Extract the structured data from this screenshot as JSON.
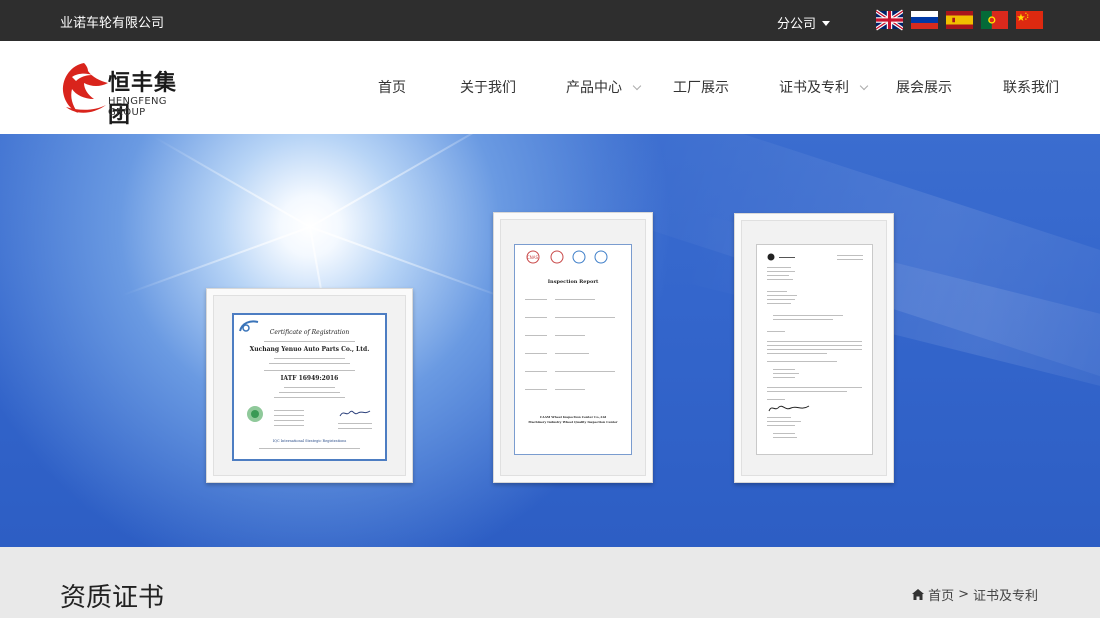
{
  "topbar": {
    "company": "业诺车轮有限公司",
    "branch_label": "分公司",
    "flags": [
      "uk-flag-icon",
      "russia-flag-icon",
      "spain-flag-icon",
      "portugal-flag-icon",
      "china-flag-icon"
    ]
  },
  "logo": {
    "cn": "恒丰集团",
    "en": "HENGFENG GROUP",
    "color": "#d9241c"
  },
  "nav": {
    "items": [
      {
        "label": "首页"
      },
      {
        "label": "关于我们"
      },
      {
        "label": "产品中心"
      },
      {
        "label": "工厂展示"
      },
      {
        "label": "证书及专利"
      },
      {
        "label": "展会展示"
      },
      {
        "label": "联系我们"
      }
    ]
  },
  "certificates": {
    "cert1": {
      "title": "Certificate of Registration",
      "company": "Xuchang Yenuo Auto Parts Co., Ltd.",
      "standard": "IATF 16949:2016",
      "footer": "IQC International Strategic Registrations"
    },
    "cert2": {
      "title": "Inspection Report",
      "footer_line1": "CAAM Wheel Inspection Center Co.,Ltd",
      "footer_line2": "Machinery Industry Wheel Quality Inspection Center"
    }
  },
  "section": {
    "title": "资质证书"
  },
  "breadcrumb": {
    "home": "首页",
    "separator": ">",
    "current": "证书及专利"
  }
}
